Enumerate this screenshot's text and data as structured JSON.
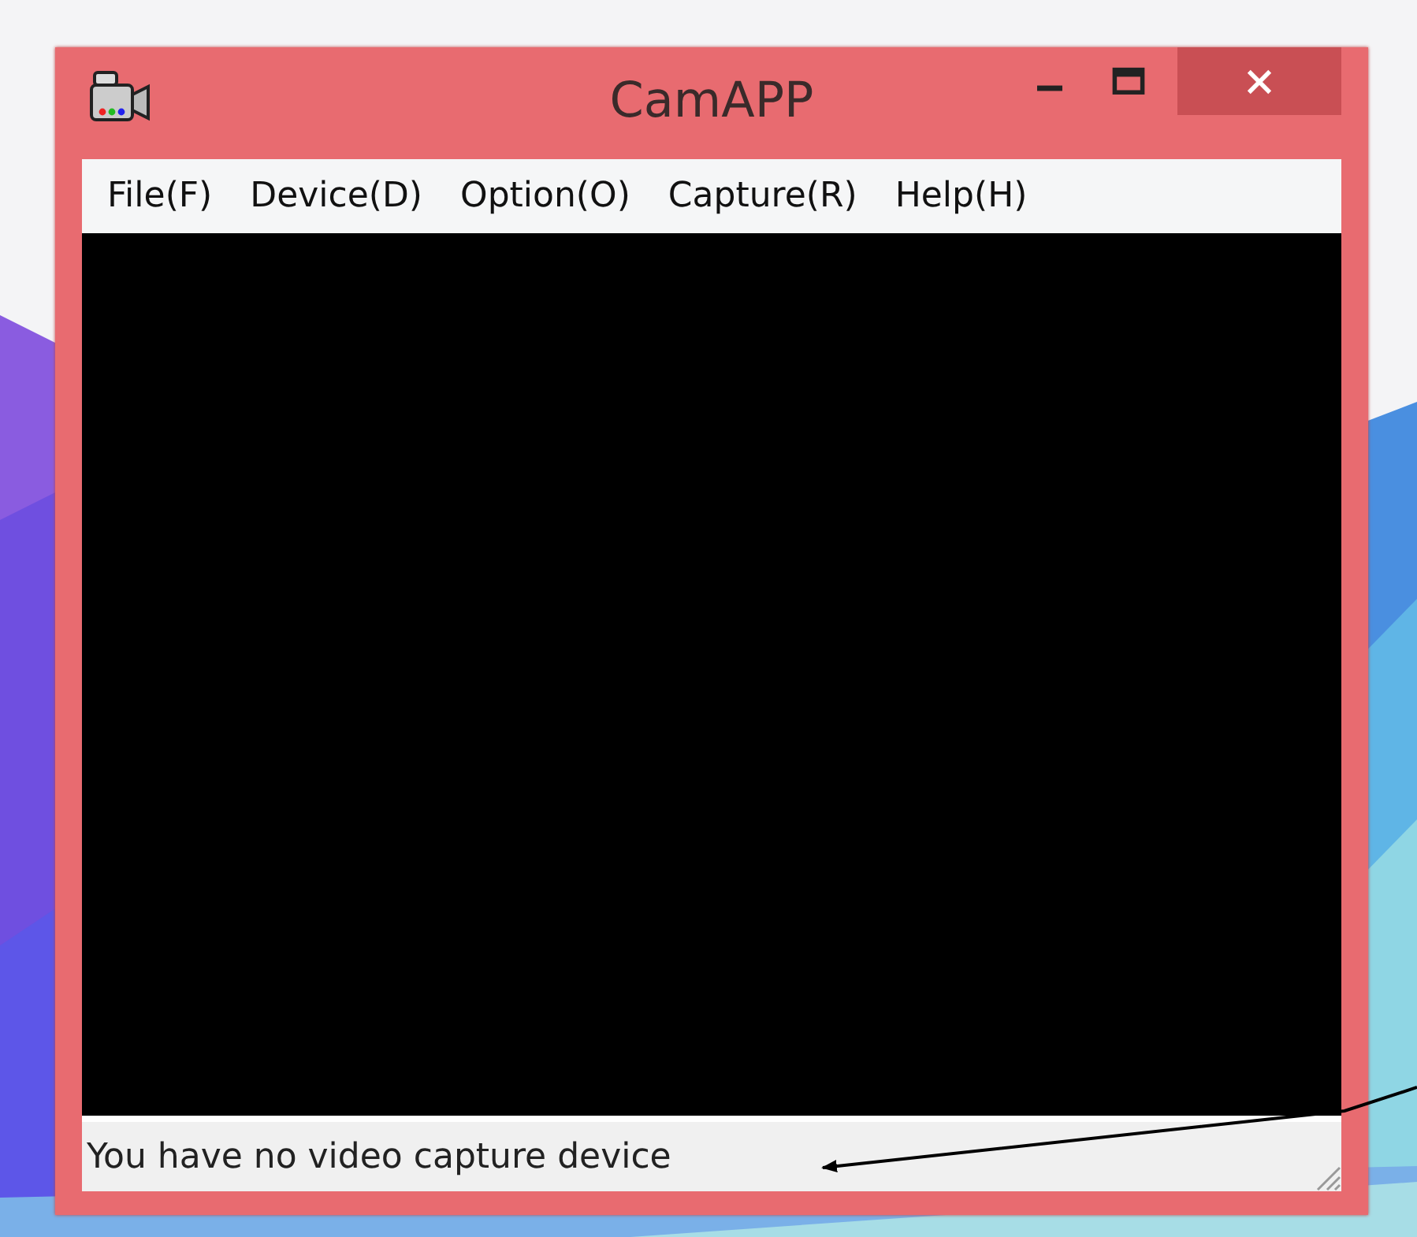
{
  "window": {
    "title": "CamAPP"
  },
  "menu": [
    {
      "label": "File(F)"
    },
    {
      "label": "Device(D)"
    },
    {
      "label": "Option(O)"
    },
    {
      "label": "Capture(R)"
    },
    {
      "label": "Help(H)"
    }
  ],
  "status_bar": {
    "text": "You have no video capture device"
  }
}
